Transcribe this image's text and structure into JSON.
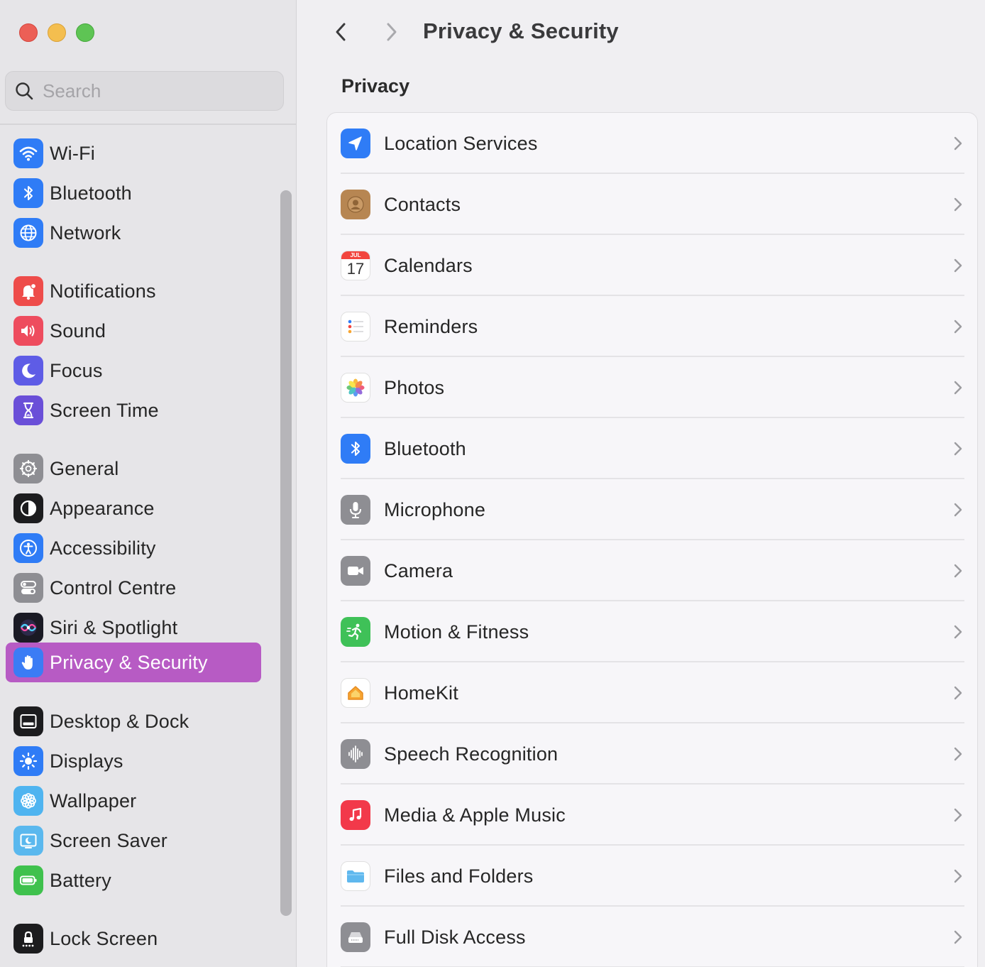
{
  "window": {
    "controls": [
      "close",
      "minimize",
      "zoom"
    ]
  },
  "search": {
    "placeholder": "Search",
    "icon": "search-icon"
  },
  "toolbar": {
    "back_icon": "chevron-left-icon",
    "forward_icon": "chevron-right-icon",
    "title": "Privacy & Security"
  },
  "sidebar": {
    "items": [
      {
        "label": "Wi-Fi",
        "icon": "wifi-icon",
        "color": "#2f7cf6"
      },
      {
        "label": "Bluetooth",
        "icon": "bluetooth-icon",
        "color": "#2f7cf6"
      },
      {
        "label": "Network",
        "icon": "globe-icon",
        "color": "#2f7cf6"
      },
      {
        "label": "Notifications",
        "icon": "bell-icon",
        "color": "#ee4c4a"
      },
      {
        "label": "Sound",
        "icon": "speaker-icon",
        "color": "#ee4c5e"
      },
      {
        "label": "Focus",
        "icon": "moon-icon",
        "color": "#5e5ce6"
      },
      {
        "label": "Screen Time",
        "icon": "hourglass-icon",
        "color": "#6a4fd8"
      },
      {
        "label": "General",
        "icon": "gear-icon",
        "color": "#8e8e93"
      },
      {
        "label": "Appearance",
        "icon": "appearance-icon",
        "color": "#1c1c1e"
      },
      {
        "label": "Accessibility",
        "icon": "accessibility-icon",
        "color": "#2f7cf6"
      },
      {
        "label": "Control Centre",
        "icon": "toggles-icon",
        "color": "#8e8e93"
      },
      {
        "label": "Siri & Spotlight",
        "icon": "siri-icon",
        "color": "#2a2a3a"
      },
      {
        "label": "Privacy & Security",
        "icon": "hand-icon",
        "color": "#3b7cf5",
        "selected": true
      },
      {
        "label": "Desktop & Dock",
        "icon": "dock-icon",
        "color": "#1c1c1e"
      },
      {
        "label": "Displays",
        "icon": "sun-icon",
        "color": "#2f7cf6"
      },
      {
        "label": "Wallpaper",
        "icon": "flower-icon",
        "color": "#4fb4f0"
      },
      {
        "label": "Screen Saver",
        "icon": "screensaver-icon",
        "color": "#5ab8ee"
      },
      {
        "label": "Battery",
        "icon": "battery-icon",
        "color": "#3fc14d"
      },
      {
        "label": "Lock Screen",
        "icon": "lock-icon",
        "color": "#1c1c1e"
      }
    ],
    "selected_color": "#b75bc4"
  },
  "main": {
    "section_title": "Privacy",
    "rows": [
      {
        "label": "Location Services",
        "icon": "location-arrow-icon",
        "color": "#2f7cf6"
      },
      {
        "label": "Contacts",
        "icon": "contacts-icon",
        "color": "#b78652"
      },
      {
        "label": "Calendars",
        "icon": "calendar-icon",
        "month": "JUL",
        "day": "17"
      },
      {
        "label": "Reminders",
        "icon": "reminders-icon"
      },
      {
        "label": "Photos",
        "icon": "photos-icon"
      },
      {
        "label": "Bluetooth",
        "icon": "bluetooth-icon",
        "color": "#2f7cf6"
      },
      {
        "label": "Microphone",
        "icon": "microphone-icon",
        "color": "#8e8e93"
      },
      {
        "label": "Camera",
        "icon": "camera-icon",
        "color": "#8e8e93"
      },
      {
        "label": "Motion & Fitness",
        "icon": "running-icon",
        "color": "#3fc158"
      },
      {
        "label": "HomeKit",
        "icon": "home-icon"
      },
      {
        "label": "Speech Recognition",
        "icon": "waveform-icon",
        "color": "#8e8e93"
      },
      {
        "label": "Media & Apple Music",
        "icon": "music-note-icon",
        "color": "#f2394a"
      },
      {
        "label": "Files and Folders",
        "icon": "folder-icon",
        "color": "#5fb8ee"
      },
      {
        "label": "Full Disk Access",
        "icon": "disk-icon",
        "color": "#8e8e93"
      }
    ]
  }
}
